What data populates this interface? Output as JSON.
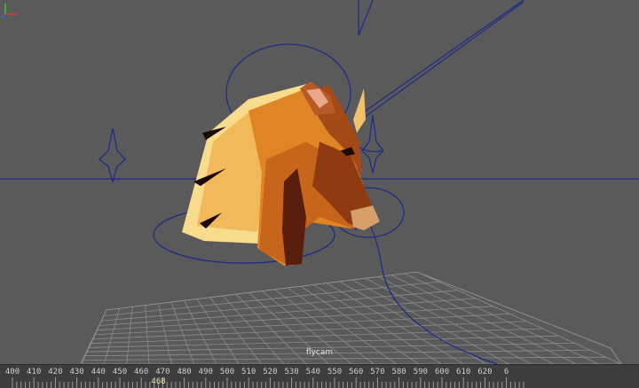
{
  "viewport": {
    "camera_name": "flycam"
  },
  "timeline": {
    "ticks": [
      "400",
      "410",
      "420",
      "430",
      "440",
      "450",
      "460",
      "470",
      "480",
      "490",
      "500",
      "510",
      "520",
      "530",
      "540",
      "550",
      "560",
      "570",
      "580",
      "590",
      "600",
      "610",
      "620",
      "6"
    ],
    "current_frame": "468"
  },
  "colors": {
    "viewport_bg": "#5a5a5a",
    "timeline_bg": "#3d3d3d",
    "curve": "#1c2a88",
    "grid": "#8a8a8a",
    "horse_main": "#d87a1c",
    "horse_mane": "#f7d78a",
    "horse_dark": "#6a2810"
  }
}
